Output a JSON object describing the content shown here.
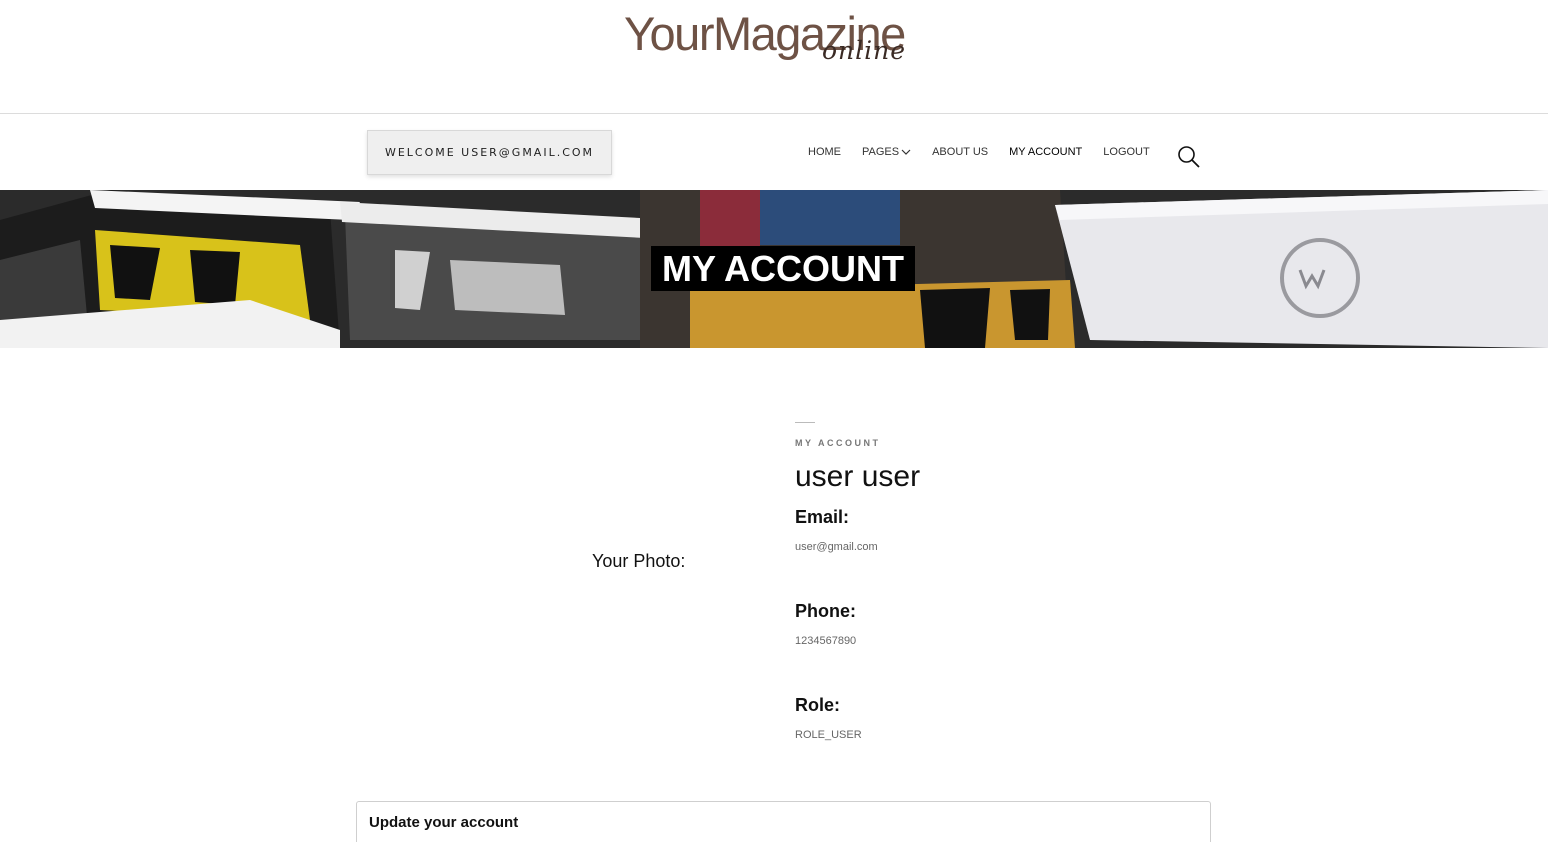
{
  "logo": {
    "main": "YourMagazine",
    "sub": "online"
  },
  "header": {
    "welcome": "WELCOME USER@GMAIL.COM"
  },
  "nav": {
    "items": [
      {
        "label": "HOME"
      },
      {
        "label": "PAGES"
      },
      {
        "label": "ABOUT US"
      },
      {
        "label": "MY ACCOUNT"
      },
      {
        "label": "LOGOUT"
      }
    ],
    "search_icon": "search-icon"
  },
  "banner": {
    "title": "MY ACCOUNT"
  },
  "profile": {
    "eyebrow": "MY ACCOUNT",
    "name": "user user",
    "photo_label": "Your Photo:",
    "email_label": "Email:",
    "email": "user@gmail.com",
    "phone_label": "Phone:",
    "phone": "1234567890",
    "role_label": "Role:",
    "role": "ROLE_USER"
  },
  "update_panel": {
    "title": "Update your account"
  },
  "colors": {
    "logo_brown": "#6e5245",
    "banner_label_bg": "#000000"
  }
}
